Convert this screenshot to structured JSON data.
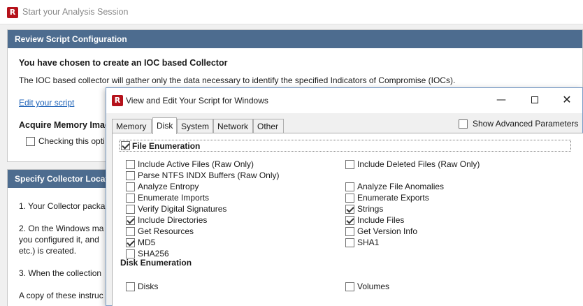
{
  "window": {
    "logo_letter": "R",
    "title": "Start your Analysis Session"
  },
  "review_panel": {
    "header": "Review Script Configuration",
    "heading": "You have chosen to create an IOC based Collector",
    "description": "The IOC based collector will gather only the data necessary to identify the specified Indicators of Compromise (IOCs).",
    "edit_link": "Edit your script",
    "acquire_heading": "Acquire Memory Imag",
    "acquire_checkbox_label": "Checking this opti"
  },
  "location_panel": {
    "header": "Specify Collector Locat",
    "step1": "1. Your Collector packa",
    "step2_line1": "2. On the Windows ma",
    "step2_line2": "you configured it, and",
    "step2_line3": "etc.) is created.",
    "step3": "3. When the collection",
    "copy_note": "A copy of these instruc"
  },
  "dialog": {
    "logo_letter": "R",
    "title": "View and Edit Your Script for Windows",
    "controls": {
      "minimize": "—",
      "close": "✕"
    },
    "tabs": [
      {
        "label": "Memory",
        "active": false
      },
      {
        "label": "Disk",
        "active": true
      },
      {
        "label": "System",
        "active": false
      },
      {
        "label": "Network",
        "active": false
      },
      {
        "label": "Other",
        "active": false
      }
    ],
    "advanced_label": "Show Advanced Parameters",
    "advanced_checked": false,
    "file_enumeration": {
      "label": "File Enumeration",
      "checked": true,
      "left_column": [
        {
          "label": "Include Active Files (Raw Only)",
          "checked": false
        },
        {
          "label": "Parse NTFS INDX Buffers (Raw Only)",
          "checked": false
        },
        {
          "label": "Analyze Entropy",
          "checked": false
        },
        {
          "label": "Enumerate Imports",
          "checked": false
        },
        {
          "label": "Verify Digital Signatures",
          "checked": false
        },
        {
          "label": "Include Directories",
          "checked": true
        },
        {
          "label": "Get Resources",
          "checked": false
        },
        {
          "label": "MD5",
          "checked": true
        },
        {
          "label": "SHA256",
          "checked": false
        }
      ],
      "right_column": [
        {
          "label": "Include Deleted Files (Raw Only)",
          "checked": false
        },
        {
          "label": "Analyze File Anomalies",
          "checked": false
        },
        {
          "label": "Enumerate Exports",
          "checked": false
        },
        {
          "label": "Strings",
          "checked": true
        },
        {
          "label": "Include Files",
          "checked": true
        },
        {
          "label": "Get Version Info",
          "checked": false
        },
        {
          "label": "SHA1",
          "checked": false
        }
      ]
    },
    "disk_enumeration": {
      "label": "Disk Enumeration",
      "items": [
        {
          "label": "Disks",
          "checked": false
        },
        {
          "label": "Volumes",
          "checked": false
        }
      ]
    }
  }
}
